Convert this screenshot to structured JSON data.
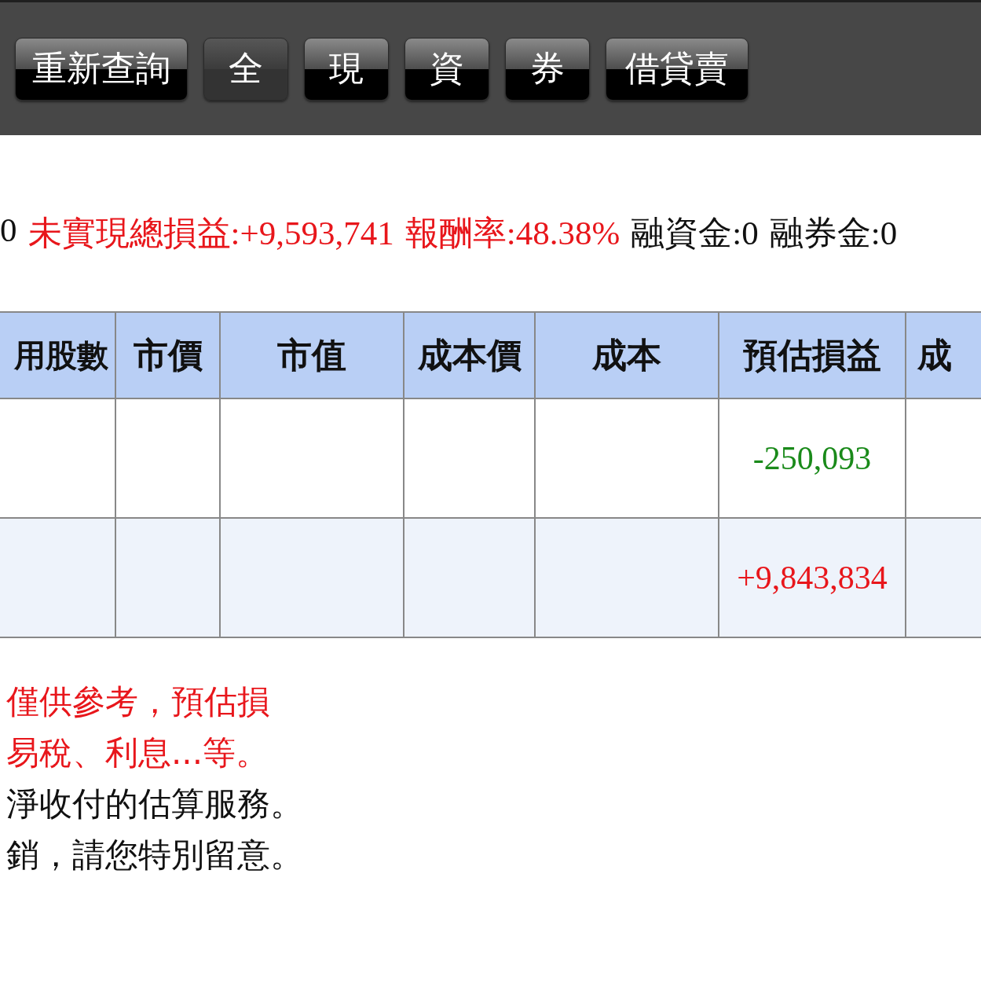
{
  "toolbar": {
    "refresh_button": "重新查詢",
    "filters": [
      {
        "label": "全",
        "selected": true
      },
      {
        "label": "現",
        "selected": false
      },
      {
        "label": "資",
        "selected": false
      },
      {
        "label": "券",
        "selected": false
      },
      {
        "label": "借貸賣",
        "selected": false
      }
    ]
  },
  "summary": [
    {
      "text": "0",
      "highlight": false
    },
    {
      "text": "未實現總損益:+9,593,741",
      "highlight": true
    },
    {
      "text": "報酬率:48.38%",
      "highlight": true
    },
    {
      "text": "融資金:0",
      "highlight": false
    },
    {
      "text": "融券金:0",
      "highlight": false
    }
  ],
  "table": {
    "columns": [
      "用股數",
      "市價",
      "市值",
      "成本價",
      "成本",
      "預估損益",
      "成"
    ],
    "rows": [
      {
        "estimated_pnl": "-250,093",
        "loss": true
      },
      {
        "estimated_pnl": "+9,843,834",
        "loss": false
      }
    ]
  },
  "notes": [
    {
      "text": "僅供參考，預估損",
      "emphasis": true
    },
    {
      "text": "易稅、利息...等。",
      "emphasis": true
    },
    {
      "text": "淨收付的估算服務。",
      "emphasis": false
    },
    {
      "text": "銷，請您特別留意。",
      "emphasis": false
    }
  ]
}
